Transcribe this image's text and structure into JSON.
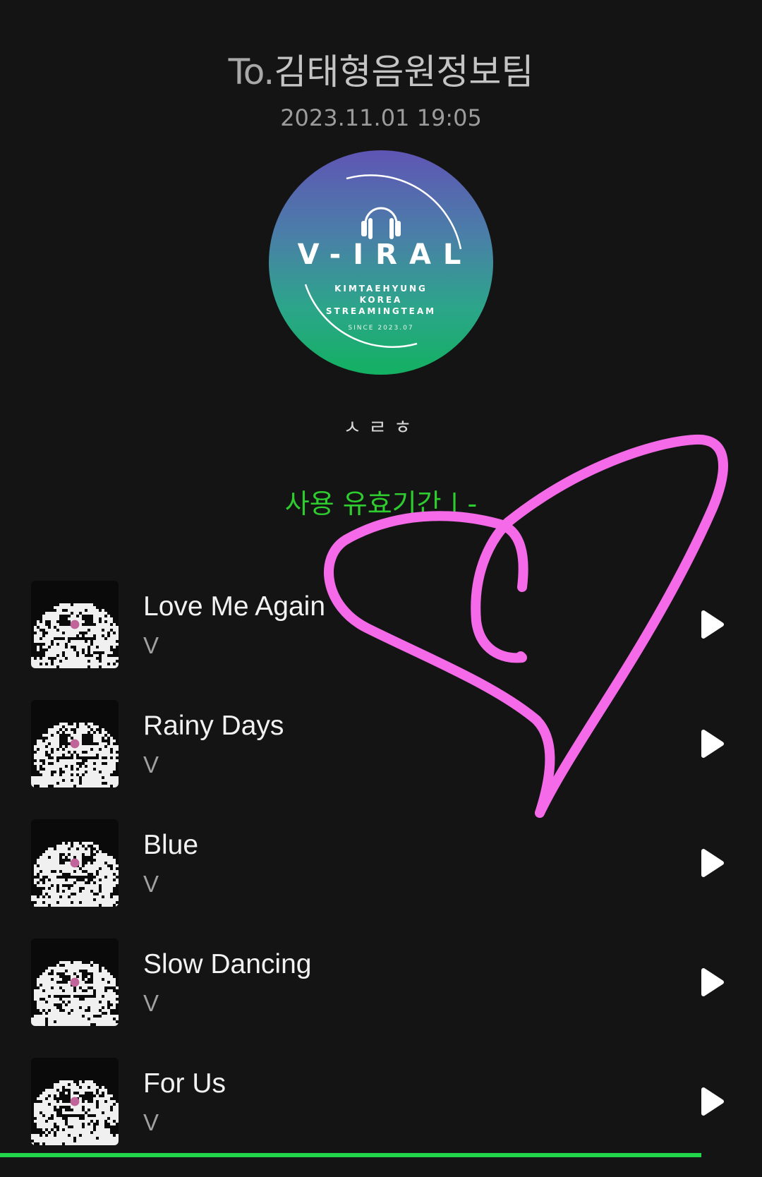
{
  "header": {
    "to_prefix": "To.",
    "recipient": "김태형음원정보팀",
    "date": "2023.11.01 19:05"
  },
  "logo": {
    "word": "V-IRAL",
    "line1": "KIMTAEHYUNG",
    "line2": "KOREA",
    "line3": "STREAMINGTEAM",
    "since": "SINCE 2023.07"
  },
  "sender": "ㅅㄹㅎ",
  "validity": "사용 유효기간 |  -",
  "tracks": [
    {
      "title": "Love Me Again",
      "artist": "V"
    },
    {
      "title": "Rainy Days",
      "artist": "V"
    },
    {
      "title": "Blue",
      "artist": "V"
    },
    {
      "title": "Slow Dancing",
      "artist": "V"
    },
    {
      "title": "For Us",
      "artist": "V"
    }
  ],
  "progress": {
    "fraction": 0.92
  },
  "colors": {
    "background": "#141414",
    "accent_green": "#2ecc2e",
    "progress_green": "#22d64c",
    "heart_pink": "#f46ae8"
  },
  "icons": {
    "play": "play-icon",
    "headphones": "headphones-icon"
  }
}
